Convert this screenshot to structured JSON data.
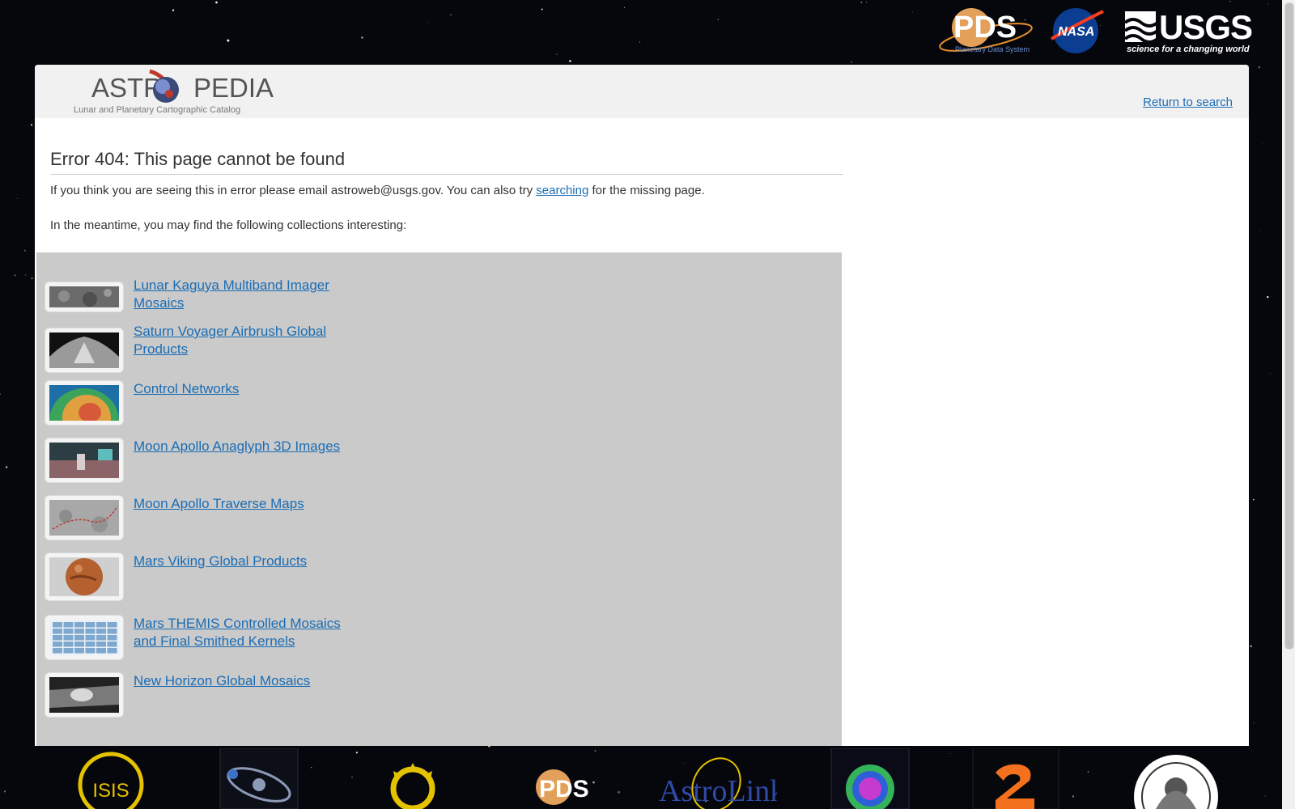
{
  "header": {
    "brand_title_left": "ASTR",
    "brand_title_right": "PEDIA",
    "brand_subtitle": "Lunar and Planetary Cartographic Catalog",
    "return_label": "Return to search"
  },
  "top_logos": {
    "pds": "PDS",
    "pds_tag": "Planetary Data System",
    "nasa": "NASA",
    "usgs": "USGS",
    "usgs_tag": "science for a changing world"
  },
  "error": {
    "title": "Error 404: This page cannot be found",
    "text_before": "If you think you are seeing this in error please email astroweb@usgs.gov. You can also try ",
    "link": "searching",
    "text_after": " for the missing page.",
    "meantime": "In the meantime, you may find the following collections interesting:"
  },
  "collections": [
    {
      "label": "Lunar Kaguya Multiband Imager Mosaics",
      "thumb": "moon-mosaic-thumb"
    },
    {
      "label": "Saturn Voyager Airbrush Global Products",
      "thumb": "saturn-thumb"
    },
    {
      "label": "Control Networks",
      "thumb": "control-network-thumb"
    },
    {
      "label": "Moon Apollo Anaglyph 3D Images",
      "thumb": "anaglyph-thumb"
    },
    {
      "label": "Moon Apollo Traverse Maps",
      "thumb": "traverse-map-thumb"
    },
    {
      "label": "Mars Viking Global Products",
      "thumb": "mars-thumb"
    },
    {
      "label": "Mars THEMIS Controlled Mosaics and Final Smithed Kernels",
      "thumb": "themis-grid-thumb"
    },
    {
      "label": "New Horizon Global Mosaics",
      "thumb": "pluto-mosaic-thumb"
    }
  ],
  "bottom_logos": {
    "isis": "ISIS",
    "pds": "PDS",
    "astrolink": "AstroLink"
  }
}
